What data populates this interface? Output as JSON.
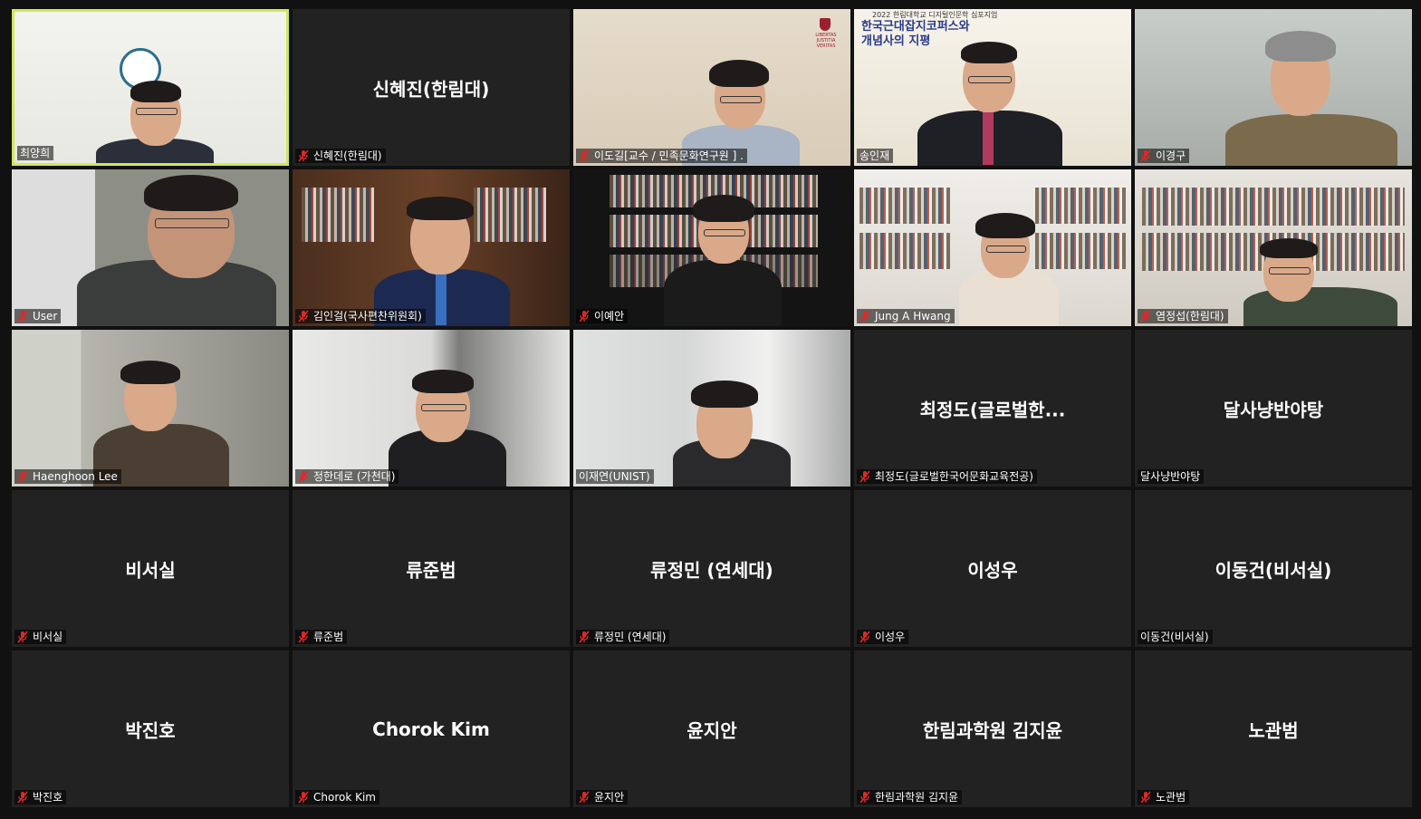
{
  "app": "Zoom meeting gallery view",
  "colors": {
    "background": "#111111",
    "tile": "#222222",
    "active_speaker_border": "#cfe85a",
    "muted_icon": "#e02828"
  },
  "tiles": [
    {
      "name": "최양희",
      "label": "최양희",
      "muted": false,
      "video": true,
      "active": true
    },
    {
      "name": "신혜진(한림대)",
      "label": "신혜진(한림대)",
      "muted": true,
      "video": false
    },
    {
      "name": "이도길",
      "label": "이도길[교수 / 민족문화연구원 ] .",
      "muted": true,
      "video": true
    },
    {
      "name": "송인재",
      "label": "송인재",
      "muted": false,
      "video": true,
      "banner": {
        "small": "2022 한림대학교 디지털인문학 심포지엄",
        "line1": "한국근대잡지코퍼스와",
        "line2": "개념사의 지평"
      }
    },
    {
      "name": "이경구",
      "label": "이경구",
      "muted": true,
      "video": true
    },
    {
      "name": "User",
      "label": "User",
      "muted": true,
      "video": true
    },
    {
      "name": "김인걸",
      "label": "김인걸(국사편찬위원회)",
      "muted": true,
      "video": true
    },
    {
      "name": "이예안",
      "label": "이예안",
      "muted": true,
      "video": true
    },
    {
      "name": "Jung A Hwang",
      "label": "Jung A Hwang",
      "muted": true,
      "video": true
    },
    {
      "name": "염정섭",
      "label": "염정섭(한림대)",
      "muted": true,
      "video": true
    },
    {
      "name": "Haenghoon Lee",
      "label": "Haenghoon Lee",
      "muted": true,
      "video": true
    },
    {
      "name": "정한데로",
      "label": "정한데로 (가천대)",
      "muted": true,
      "video": true
    },
    {
      "name": "이재연",
      "label": "이재연(UNIST)",
      "muted": false,
      "video": true
    },
    {
      "name": "최정도(글로벌한...",
      "label": "최정도(글로벌한국어문화교육전공)",
      "muted": true,
      "video": false
    },
    {
      "name": "달사냥반야탕",
      "label": "달사냥반야탕",
      "muted": false,
      "video": false
    },
    {
      "name": "비서실",
      "label": "비서실",
      "muted": true,
      "video": false
    },
    {
      "name": "류준범",
      "label": "류준범",
      "muted": true,
      "video": false
    },
    {
      "name": "류정민 (연세대)",
      "label": "류정민 (연세대)",
      "muted": true,
      "video": false
    },
    {
      "name": "이성우",
      "label": "이성우",
      "muted": true,
      "video": false
    },
    {
      "name": "이동건(비서실)",
      "label": "이동건(비서실)",
      "muted": false,
      "video": false
    },
    {
      "name": "박진호",
      "label": "박진호",
      "muted": true,
      "video": false
    },
    {
      "name": "Chorok Kim",
      "label": "Chorok Kim",
      "muted": true,
      "video": false
    },
    {
      "name": "윤지안",
      "label": "윤지안",
      "muted": true,
      "video": false
    },
    {
      "name": "한림과학원 김지윤",
      "label": "한림과학원 김지윤",
      "muted": true,
      "video": false
    },
    {
      "name": "노관범",
      "label": "노관범",
      "muted": true,
      "video": false
    }
  ]
}
